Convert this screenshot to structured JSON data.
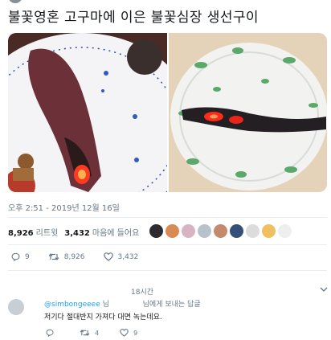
{
  "tweet": {
    "text": "불꽃영혼 고구마에 이은 불꽃심장 생선구이",
    "timestamp": "오후 2:51 - 2019년 12월 16일"
  },
  "stats": {
    "retweets_count": "8,926",
    "retweets_label": "리트윗",
    "likes_count": "3,432",
    "likes_label": "마음에 들어요"
  },
  "actions": {
    "reply_count": "9",
    "retweet_count": "8,926",
    "like_count": "3,432"
  },
  "reply": {
    "time": "18시간",
    "mention": "@simbongeeee",
    "mention_suffix": "님",
    "header_tail": "님에게 보내는 답글",
    "text": "저기다 절대반지 가져다 대면 녹는데요.",
    "reply_count": "",
    "retweet_count": "4",
    "like_count": "9"
  },
  "colors": {
    "link": "#1da1f2",
    "secondary_text": "#657786",
    "primary_text": "#14171a",
    "divider": "#e6ecf0"
  },
  "icons": [
    "reply-icon",
    "retweet-icon",
    "heart-icon",
    "share-icon",
    "chevron-down-icon"
  ]
}
